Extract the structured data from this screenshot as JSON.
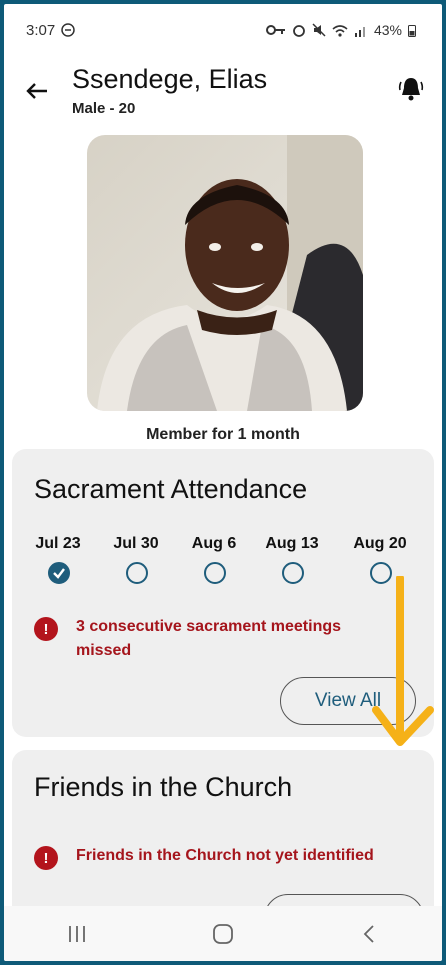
{
  "status": {
    "time": "3:07",
    "battery": "43%"
  },
  "header": {
    "name": "Ssendege, Elias",
    "subtitle": "Male - 20"
  },
  "profile": {
    "member_for": "Member for 1 month"
  },
  "attendance": {
    "title": "Sacrament Attendance",
    "dates": [
      {
        "label": "Jul 23",
        "attended": true
      },
      {
        "label": "Jul 30",
        "attended": false
      },
      {
        "label": "Aug 6",
        "attended": false
      },
      {
        "label": "Aug 13",
        "attended": false
      },
      {
        "label": "Aug 20",
        "attended": false
      }
    ],
    "alert": "3 consecutive sacrament meetings missed",
    "view_all": "View All"
  },
  "friends": {
    "title": "Friends in the Church",
    "alert": "Friends in the Church not yet identified"
  },
  "colors": {
    "accent": "#1f5d7c",
    "alert": "#a5151c",
    "annotation_arrow": "#f5b118"
  },
  "icons": [
    "back-arrow-icon",
    "bell-icon",
    "check-icon",
    "alert-icon",
    "recent-apps-icon",
    "home-icon",
    "nav-back-icon"
  ]
}
